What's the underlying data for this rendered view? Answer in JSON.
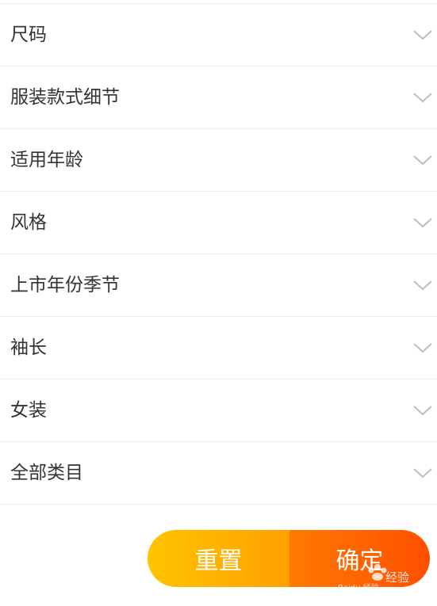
{
  "filters": [
    {
      "label": "尺码"
    },
    {
      "label": "服装款式细节"
    },
    {
      "label": "适用年龄"
    },
    {
      "label": "风格"
    },
    {
      "label": "上市年份季节"
    },
    {
      "label": "袖长"
    },
    {
      "label": "女装"
    },
    {
      "label": "全部类目"
    }
  ],
  "actions": {
    "reset_label": "重置",
    "confirm_label": "确定"
  },
  "watermark": {
    "brand": "经验",
    "sub": "Baidu 经验"
  },
  "colors": {
    "text": "#333333",
    "divider": "#ececec",
    "chevron": "#bdbdbd",
    "reset_start": "#ffc400",
    "reset_end": "#ffa000",
    "confirm_start": "#ff7a00",
    "confirm_end": "#ff4f00"
  },
  "icons": {
    "row_icon": "chevron-down-icon"
  }
}
